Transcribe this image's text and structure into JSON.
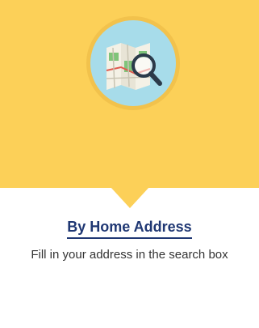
{
  "card": {
    "icon": "map-search-icon",
    "title": "By Home Address",
    "description": "Fill in your address in the search box",
    "colors": {
      "hero_background": "#fcd058",
      "icon_circle": "#a7dcea",
      "title_color": "#1f3773"
    }
  }
}
